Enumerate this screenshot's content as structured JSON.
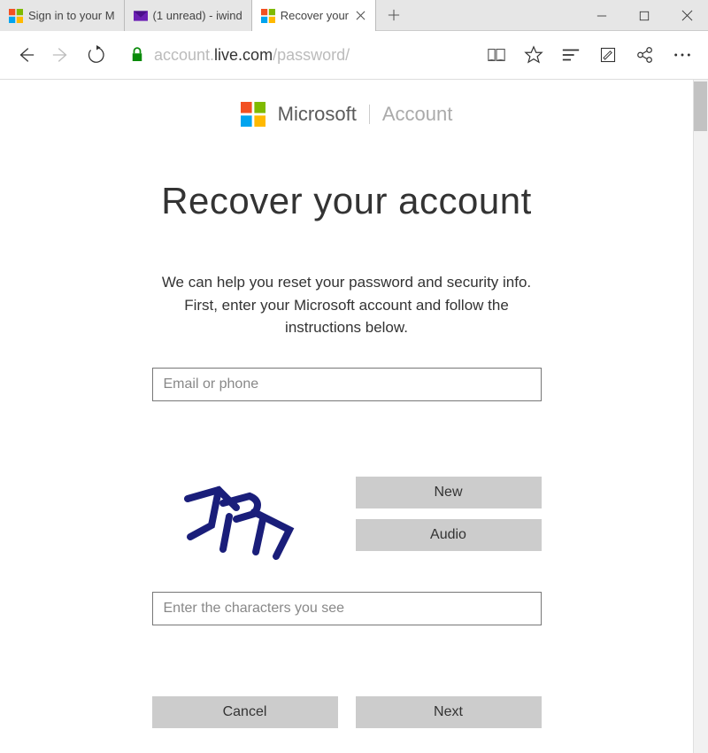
{
  "window": {
    "tabs": [
      {
        "label": "Sign in to your M"
      },
      {
        "label": "(1 unread) - iwind"
      },
      {
        "label": "Recover your"
      }
    ]
  },
  "address": {
    "host_prefix": "account.",
    "host_main": "live.com",
    "path": "/password/"
  },
  "header": {
    "brand": "Microsoft",
    "section": "Account"
  },
  "main": {
    "title": "Recover your account",
    "description": "We can help you reset your password and security info. First, enter your Microsoft account and follow the instructions below.",
    "email_placeholder": "Email or phone",
    "captcha_placeholder": "Enter the characters you see",
    "btn_new": "New",
    "btn_audio": "Audio",
    "btn_cancel": "Cancel",
    "btn_next": "Next"
  }
}
